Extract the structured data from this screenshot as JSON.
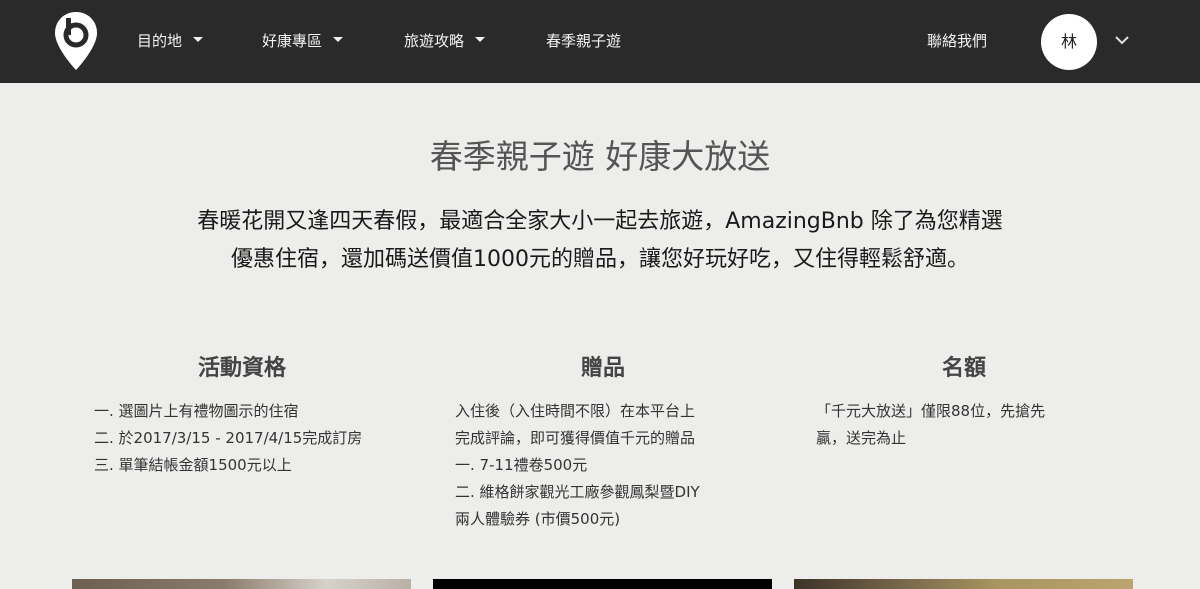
{
  "header": {
    "logo_icon": "map-pin-b-icon",
    "nav": [
      {
        "label": "目的地",
        "has_dropdown": true
      },
      {
        "label": "好康專區",
        "has_dropdown": true
      },
      {
        "label": "旅遊攻略",
        "has_dropdown": true
      },
      {
        "label": "春季親子遊",
        "has_dropdown": false
      }
    ],
    "contact_label": "聯絡我們",
    "avatar_initial": "林",
    "user_menu_icon": "chevron-down-icon"
  },
  "hero": {
    "title": "春季親子遊 好康大放送",
    "description_line1": "春暖花開又逢四天春假，最適合全家大小一起去旅遊，AmazingBnb 除了為您精選",
    "description_line2": "優惠住宿，還加碼送價值1000元的贈品，讓您好玩好吃，又住得輕鬆舒適。"
  },
  "sections": {
    "eligibility": {
      "heading": "活動資格",
      "lines": [
        "一. 選圖片上有禮物圖示的住宿",
        "二. 於2017/3/15 - 2017/4/15完成訂房",
        "三. 單筆結帳金額1500元以上"
      ]
    },
    "gifts": {
      "heading": "贈品",
      "lines": [
        "入住後（入住時間不限）在本平台上",
        "完成評論，即可獲得價值千元的贈品",
        "一. 7-11禮卷500元",
        "二. 維格餅家觀光工廠參觀鳳梨暨DIY",
        "兩人體驗券 (市價500元)"
      ]
    },
    "quota": {
      "heading": "名額",
      "lines": [
        "「千元大放送」僅限88位，先搶先",
        "贏，送完為止"
      ]
    }
  },
  "colors": {
    "header_bg": "#2a2a2a",
    "page_bg": "#ededeb",
    "header_text": "#f2f2f2"
  }
}
